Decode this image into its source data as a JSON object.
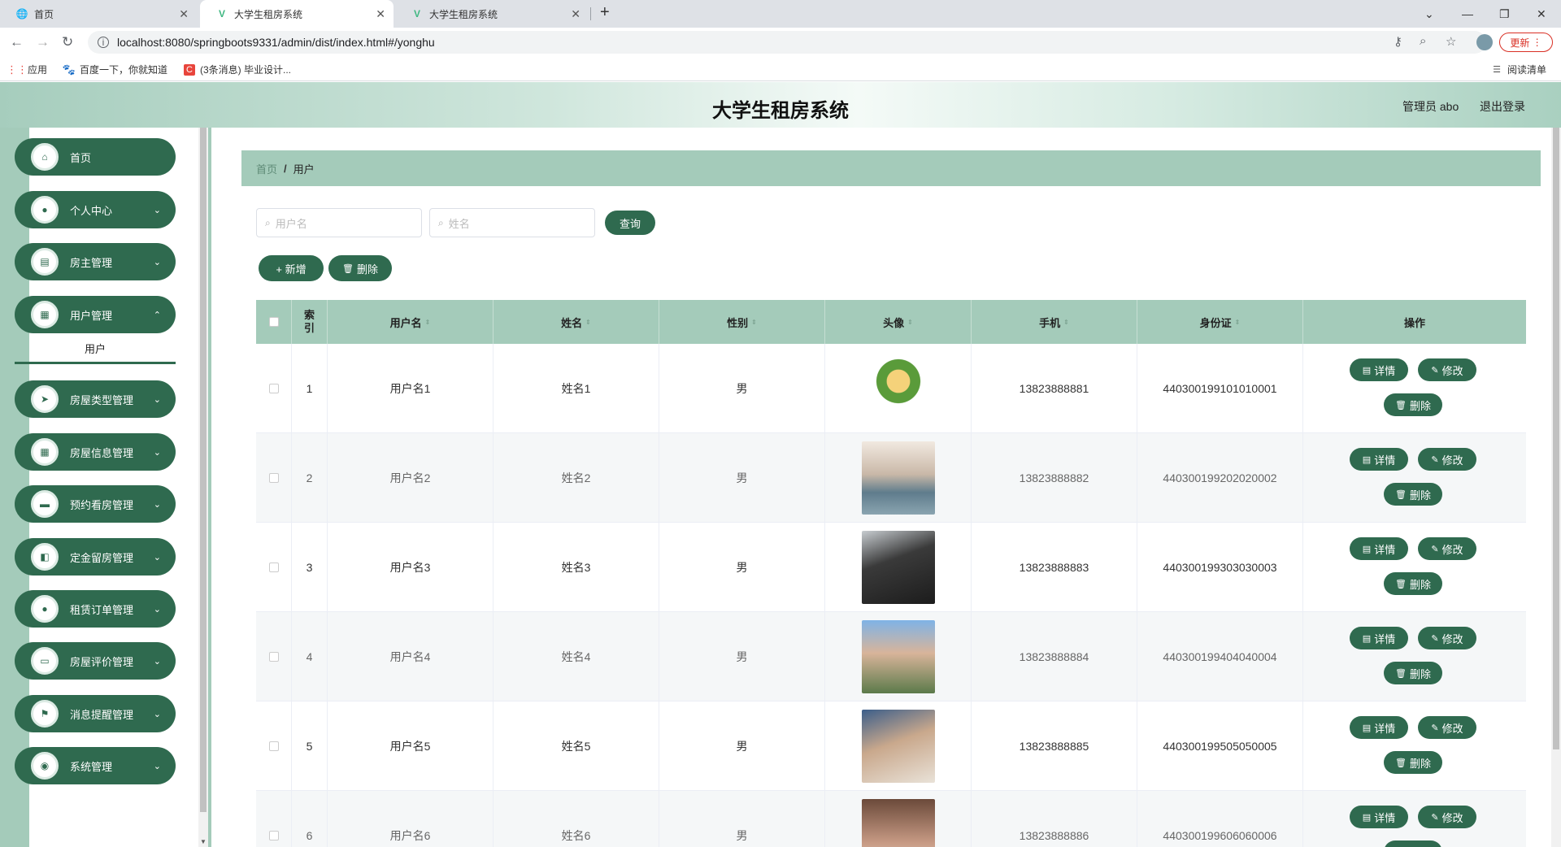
{
  "browser": {
    "tabs": [
      {
        "title": "首页",
        "icon": "globe-icon"
      },
      {
        "title": "大学生租房系统",
        "icon": "vue-icon"
      },
      {
        "title": "大学生租房系统",
        "icon": "vue-icon"
      }
    ],
    "url": "localhost:8080/springboots9331/admin/dist/index.html#/yonghu",
    "update_label": "更新",
    "bookmarks": [
      {
        "label": "应用"
      },
      {
        "label": "百度一下，你就知道"
      },
      {
        "label": "(3条消息) 毕业设计..."
      }
    ],
    "reading_list": "阅读清单"
  },
  "header": {
    "title": "大学生租房系统",
    "admin_label": "管理员 abo",
    "logout_label": "退出登录"
  },
  "sidebar": {
    "items": [
      {
        "label": "首页",
        "icon": "home-icon",
        "expandable": false
      },
      {
        "label": "个人中心",
        "icon": "user-icon",
        "expandable": true
      },
      {
        "label": "房主管理",
        "icon": "clipboard-icon",
        "expandable": true
      },
      {
        "label": "用户管理",
        "icon": "grid-icon",
        "expandable": true,
        "open": true
      },
      {
        "label": "房屋类型管理",
        "icon": "send-icon",
        "expandable": true
      },
      {
        "label": "房屋信息管理",
        "icon": "grid-icon",
        "expandable": true
      },
      {
        "label": "预约看房管理",
        "icon": "monitor-icon",
        "expandable": true
      },
      {
        "label": "定金留房管理",
        "icon": "bag-icon",
        "expandable": true
      },
      {
        "label": "租赁订单管理",
        "icon": "user-icon",
        "expandable": true
      },
      {
        "label": "房屋评价管理",
        "icon": "ticket-icon",
        "expandable": true
      },
      {
        "label": "消息提醒管理",
        "icon": "flag-icon",
        "expandable": true
      },
      {
        "label": "系统管理",
        "icon": "camera-icon",
        "expandable": true
      }
    ],
    "submenu": {
      "label": "用户"
    }
  },
  "breadcrumb": {
    "home": "首页",
    "separator": "/",
    "current": "用户"
  },
  "search": {
    "username_placeholder": "用户名",
    "name_placeholder": "姓名",
    "query_label": "查询"
  },
  "actions": {
    "add_label": "+ 新增",
    "delete_label": "删除"
  },
  "table": {
    "columns": [
      "索引",
      "用户名",
      "姓名",
      "性别",
      "头像",
      "手机",
      "身份证",
      "操作"
    ],
    "rows": [
      {
        "index": "1",
        "username": "用户名1",
        "name": "姓名1",
        "gender": "男",
        "phone": "13823888881",
        "id_card": "440300199101010001"
      },
      {
        "index": "2",
        "username": "用户名2",
        "name": "姓名2",
        "gender": "男",
        "phone": "13823888882",
        "id_card": "440300199202020002"
      },
      {
        "index": "3",
        "username": "用户名3",
        "name": "姓名3",
        "gender": "男",
        "phone": "13823888883",
        "id_card": "440300199303030003"
      },
      {
        "index": "4",
        "username": "用户名4",
        "name": "姓名4",
        "gender": "男",
        "phone": "13823888884",
        "id_card": "440300199404040004"
      },
      {
        "index": "5",
        "username": "用户名5",
        "name": "姓名5",
        "gender": "男",
        "phone": "13823888885",
        "id_card": "440300199505050005"
      },
      {
        "index": "6",
        "username": "用户名6",
        "name": "姓名6",
        "gender": "男",
        "phone": "13823888886",
        "id_card": "440300199606060006"
      }
    ],
    "row_buttons": {
      "detail": "详情",
      "edit": "修改",
      "delete": "删除"
    }
  },
  "colors": {
    "accent": "#2f6a4f",
    "accent_light": "#a4cbba"
  }
}
